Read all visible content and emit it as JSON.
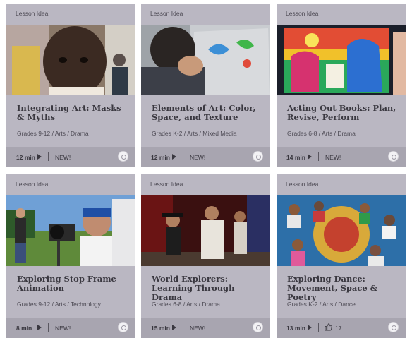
{
  "cards": [
    {
      "type_label": "Lesson Idea",
      "title": "Integrating Art: Masks & Myths",
      "grades": "Grades 9-12 / Arts / Drama",
      "duration": "12 min",
      "badge": "NEW!",
      "thumbnail_icon": "mask-photo"
    },
    {
      "type_label": "Lesson Idea",
      "title": "Elements of Art: Color, Space, and Texture",
      "grades": "Grades K-2 / Arts / Mixed Media",
      "duration": "12 min",
      "badge": "NEW!",
      "thumbnail_icon": "foil-art-photo"
    },
    {
      "type_label": "Lesson Idea",
      "title": "Acting Out Books: Plan, Revise, Perform",
      "grades": "Grades 6-8 / Arts / Drama",
      "duration": "14 min",
      "badge": "NEW!",
      "thumbnail_icon": "picture-book-photo"
    },
    {
      "type_label": "Lesson Idea",
      "title": "Exploring Stop Frame Animation",
      "grades": "Grades 9-12 / Arts / Technology",
      "duration": "8 min",
      "badge": "NEW!",
      "thumbnail_icon": "camera-photo"
    },
    {
      "type_label": "Lesson Idea",
      "title": "World Explorers: Learning Through Drama",
      "grades": "Grades 6-8 / Arts / Drama",
      "duration": "15 min",
      "badge": "NEW!",
      "thumbnail_icon": "stage-photo"
    },
    {
      "type_label": "Lesson Idea",
      "title": "Exploring Dance: Movement, Space & Poetry",
      "grades": "Grades K-2 / Arts / Dance",
      "duration": "13 min",
      "likes": "17",
      "thumbnail_icon": "dance-circle-photo"
    }
  ]
}
